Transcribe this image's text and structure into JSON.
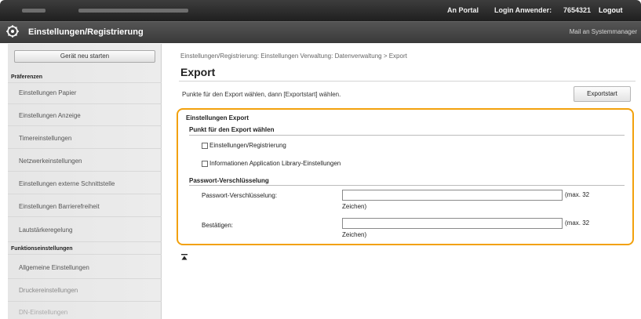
{
  "header": {
    "portal_link": "An Portal",
    "login_label": "Login Anwender:",
    "user_id": "7654321",
    "logout_link": "Logout"
  },
  "titlebar": {
    "title": "Einstellungen/Registrierung",
    "mail_link": "Mail an Systemmanager"
  },
  "sidebar": {
    "restart_button": "Gerät neu starten",
    "sections": [
      {
        "label": "Präferenzen",
        "items": [
          "Einstellungen Papier",
          "Einstellungen Anzeige",
          "Timereinstellungen",
          "Netzwerkeinstellungen",
          "Einstellungen externe Schnittstelle",
          "Einstellungen Barrierefreiheit",
          "Lautstärkeregelung"
        ]
      },
      {
        "label": "Funktionseinstellungen",
        "items": [
          "Allgemeine Einstellungen",
          "Druckereinstellungen",
          "DN-Einstellungen"
        ]
      }
    ]
  },
  "main": {
    "breadcrumb": "Einstellungen/Registrierung: Einstellungen Verwaltung: Datenverwaltung > Export",
    "page_title": "Export",
    "instruction": "Punkte für den Export wählen, dann [Exportstart] wählen.",
    "export_start_button": "Exportstart"
  },
  "export_settings": {
    "heading": "Einstellungen Export",
    "select_items_heading": "Punkt für den Export wählen",
    "checkboxes": [
      {
        "label": "Einstellungen/Registrierung",
        "checked": false
      },
      {
        "label": "Informationen Application Library-Einstellungen",
        "checked": false
      }
    ],
    "encryption_heading": "Passwort-Verschlüsselung",
    "fields": [
      {
        "label": "Passwort-Verschlüsselung:",
        "value": "",
        "hint_line1": "(max. 32",
        "hint_line2": "Zeichen)"
      },
      {
        "label": "Bestätigen:",
        "value": "",
        "hint_line1": "(max. 32",
        "hint_line2": "Zeichen)"
      }
    ]
  },
  "icons": {
    "logo": "settings-gear-icon",
    "back_to_top": "back-to-top-icon"
  },
  "colors": {
    "accent_orange": "#f2a10c",
    "topbar_dark": "#2b2b2b",
    "sidebar_bg": "#e8e8e8"
  }
}
